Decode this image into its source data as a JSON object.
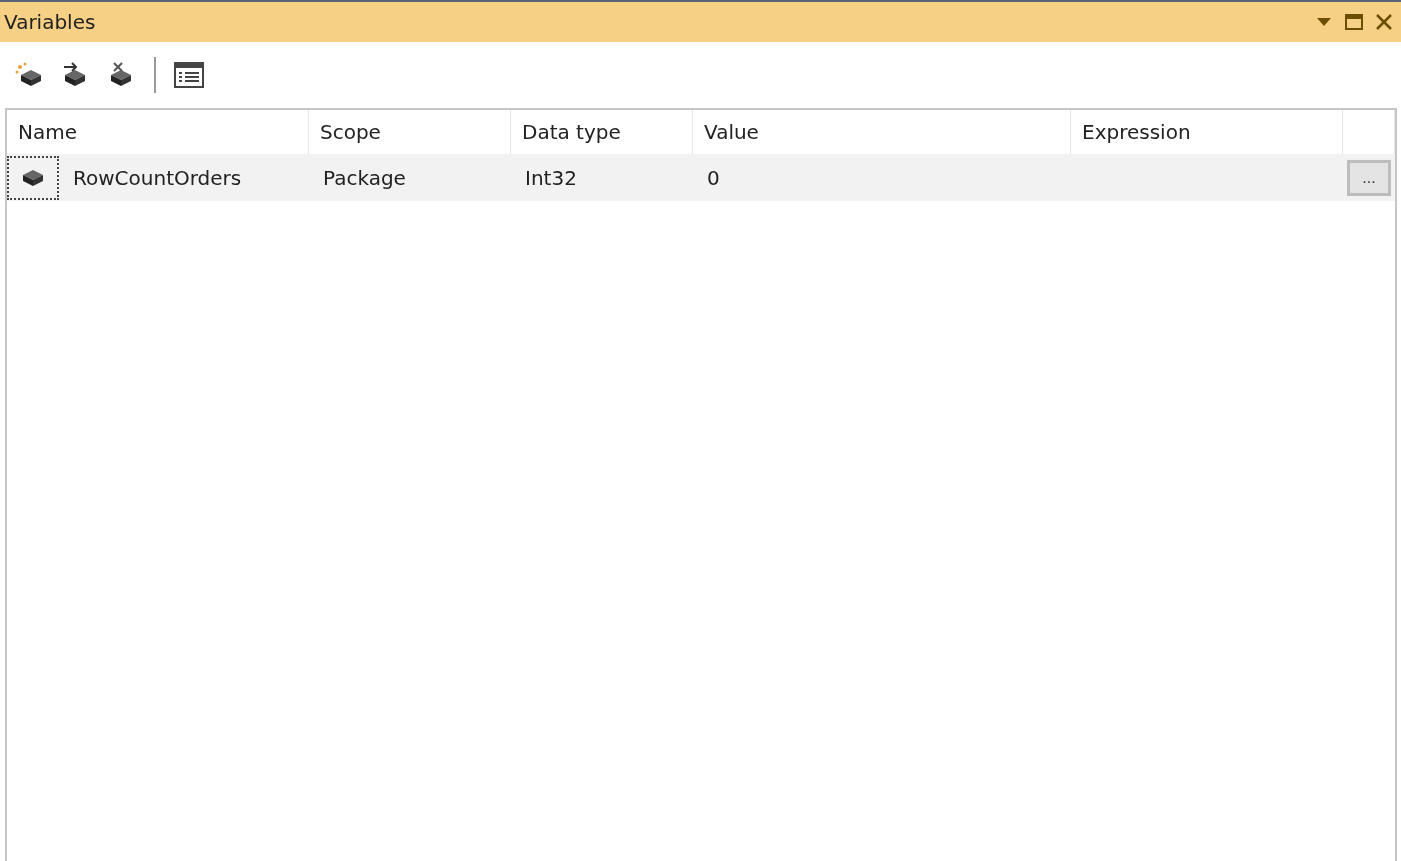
{
  "window": {
    "title": "Variables"
  },
  "columns": [
    "Name",
    "Scope",
    "Data type",
    "Value",
    "Expression"
  ],
  "rows": [
    {
      "selected": true,
      "name": "RowCountOrders",
      "scope": "Package",
      "data_type": "Int32",
      "value": "0",
      "expression": "",
      "button": "..."
    }
  ]
}
